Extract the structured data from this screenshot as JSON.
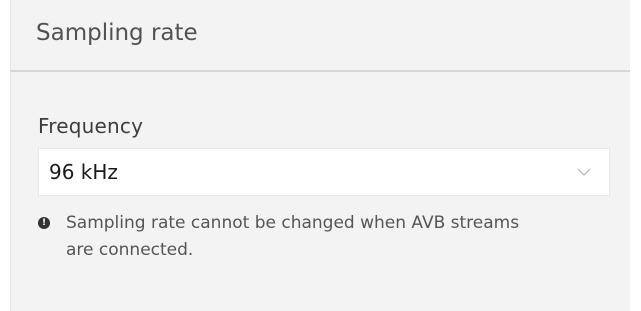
{
  "panel": {
    "title": "Sampling rate"
  },
  "frequency": {
    "label": "Frequency",
    "selected_value": "96 kHz",
    "dropdown_icon": "chevron-down-icon"
  },
  "note": {
    "icon": "info-icon",
    "icon_glyph": "!",
    "text": "Sampling rate cannot be changed when AVB streams are connected."
  }
}
